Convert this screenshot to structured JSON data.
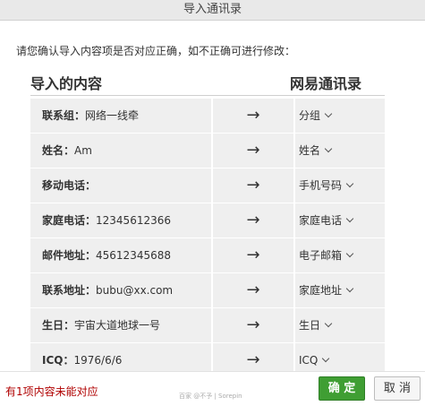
{
  "window": {
    "title": "导入通讯录"
  },
  "instruction": "请您确认导入内容项是否对应正确，如不正确可进行修改：",
  "headers": {
    "left": "导入的内容",
    "right": "网易通讯录"
  },
  "rows": [
    {
      "key": "联系组：",
      "value": "网络一线牵",
      "target": "分组"
    },
    {
      "key": "姓名：",
      "value": "Am",
      "target": "姓名"
    },
    {
      "key": "移动电话：",
      "value": "",
      "target": "手机号码"
    },
    {
      "key": "家庭电话：",
      "value": "12345612366",
      "target": "家庭电话"
    },
    {
      "key": "邮件地址：",
      "value": "45612345688",
      "target": "电子邮箱"
    },
    {
      "key": "联系地址：",
      "value": "bubu@xx.com",
      "target": "家庭地址"
    },
    {
      "key": "生日：",
      "value": "宇宙大道地球一号",
      "target": "生日"
    },
    {
      "key": "ICQ：",
      "value": "1976/6/6",
      "target": "ICQ"
    }
  ],
  "arrow_glyph": "→",
  "footer": {
    "warning": "有1项内容未能对应",
    "watermark": "百家 @不予 | Sorepin",
    "ok_label": "确 定",
    "cancel_label": "取 消"
  },
  "colors": {
    "ok_button": "#3f9e33",
    "warning_text": "#b00000",
    "row_background": "#efefef"
  }
}
